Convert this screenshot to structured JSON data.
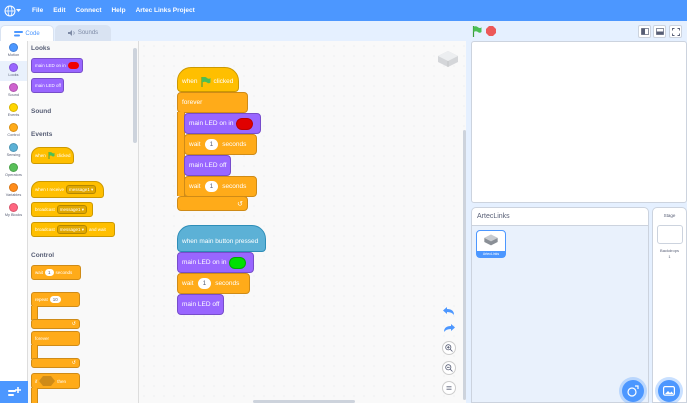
{
  "menu": {
    "file": "File",
    "edit": "Edit",
    "connect": "Connect",
    "help": "Help",
    "project_title": "Artec Links Project"
  },
  "tabs": {
    "code": "Code",
    "sounds": "Sounds"
  },
  "categories": [
    {
      "label": "Motion",
      "color": "#4c97ff"
    },
    {
      "label": "Looks",
      "color": "#9966ff"
    },
    {
      "label": "Sound",
      "color": "#cf63cf"
    },
    {
      "label": "Events",
      "color": "#ffd500"
    },
    {
      "label": "Control",
      "color": "#ffab19"
    },
    {
      "label": "Sensing",
      "color": "#5cb1d6"
    },
    {
      "label": "Operators",
      "color": "#59c059"
    },
    {
      "label": "Variables",
      "color": "#ff8c1a"
    },
    {
      "label": "My Blocks",
      "color": "#ff6680"
    }
  ],
  "palette": {
    "looks_title": "Looks",
    "led_on": "main LED on in",
    "led_off": "main LED off",
    "sound_title": "Sound",
    "events_title": "Events",
    "when": "when",
    "clicked": "clicked",
    "when_i_receive": "when I receive",
    "message1": "message1",
    "broadcast": "broadcast",
    "and_wait": "and wait",
    "control_title": "Control",
    "wait": "wait",
    "wait_val": "1",
    "seconds": "seconds",
    "repeat": "repeat",
    "repeat_val": "10",
    "forever": "forever",
    "if": "if",
    "then": "then"
  },
  "script1": {
    "when": "when",
    "clicked": "clicked",
    "forever": "forever",
    "led_on": "main LED on in",
    "wait": "wait",
    "wait1_val": "1",
    "seconds": "seconds",
    "led_off": "main LED off",
    "wait2_val": "1"
  },
  "script2": {
    "hat": "when main button pressed",
    "led_on": "main LED on in",
    "wait": "wait",
    "wait_val": "1",
    "seconds": "seconds",
    "led_off": "main LED off"
  },
  "sprites": {
    "title": "ArtecLinks",
    "sprite_name": "ArtecLinks"
  },
  "stage_panel": {
    "title": "Stage",
    "backdrops_label": "Backdrops",
    "backdrops_count": "1"
  }
}
